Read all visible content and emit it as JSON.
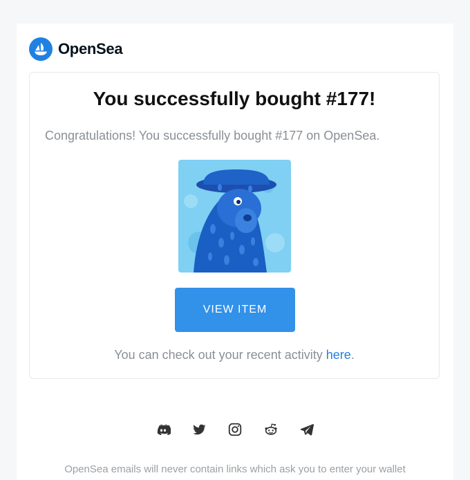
{
  "brand": {
    "name": "OpenSea",
    "logo_icon": "opensea-logo-icon",
    "logo_color": "#2081e2"
  },
  "card": {
    "title": "You successfully bought #177!",
    "message": "Congratulations! You successfully bought #177 on OpenSea.",
    "image_icon": "nft-bear-image",
    "button_label": "VIEW ITEM",
    "button_color": "#3291e9",
    "activity_prefix": "You can check out your recent activity ",
    "activity_link": "here",
    "activity_suffix": "."
  },
  "socials": [
    {
      "name": "discord-icon"
    },
    {
      "name": "twitter-icon"
    },
    {
      "name": "instagram-icon"
    },
    {
      "name": "reddit-icon"
    },
    {
      "name": "telegram-icon"
    }
  ],
  "footer": {
    "text": "OpenSea emails will never contain links which ask you to enter your wallet"
  }
}
